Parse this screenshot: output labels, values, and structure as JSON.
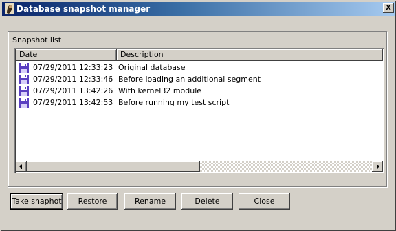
{
  "window": {
    "title": "Database snapshot manager",
    "close_label": "X"
  },
  "group": {
    "label": "Snapshot list"
  },
  "list": {
    "columns": [
      "Date",
      "Description"
    ],
    "rows": [
      {
        "date": "07/29/2011 12:33:23",
        "description": "Original database",
        "icon": "floppy-disk-icon"
      },
      {
        "date": "07/29/2011 12:33:46",
        "description": "Before loading an additional segment",
        "icon": "floppy-disk-icon"
      },
      {
        "date": "07/29/2011 13:42:26",
        "description": "With kernel32 module",
        "icon": "floppy-disk-icon"
      },
      {
        "date": "07/29/2011 13:42:53",
        "description": "Before running my test script",
        "icon": "floppy-disk-icon"
      }
    ]
  },
  "buttons": {
    "take_snapshot": "Take snaphot",
    "restore": "Restore",
    "rename": "Rename",
    "delete": "Delete",
    "close": "Close"
  },
  "colors": {
    "titlebar_start": "#0a246a",
    "titlebar_end": "#a6caf0",
    "face": "#d4d0c8",
    "floppy": "#5a3fc0"
  }
}
